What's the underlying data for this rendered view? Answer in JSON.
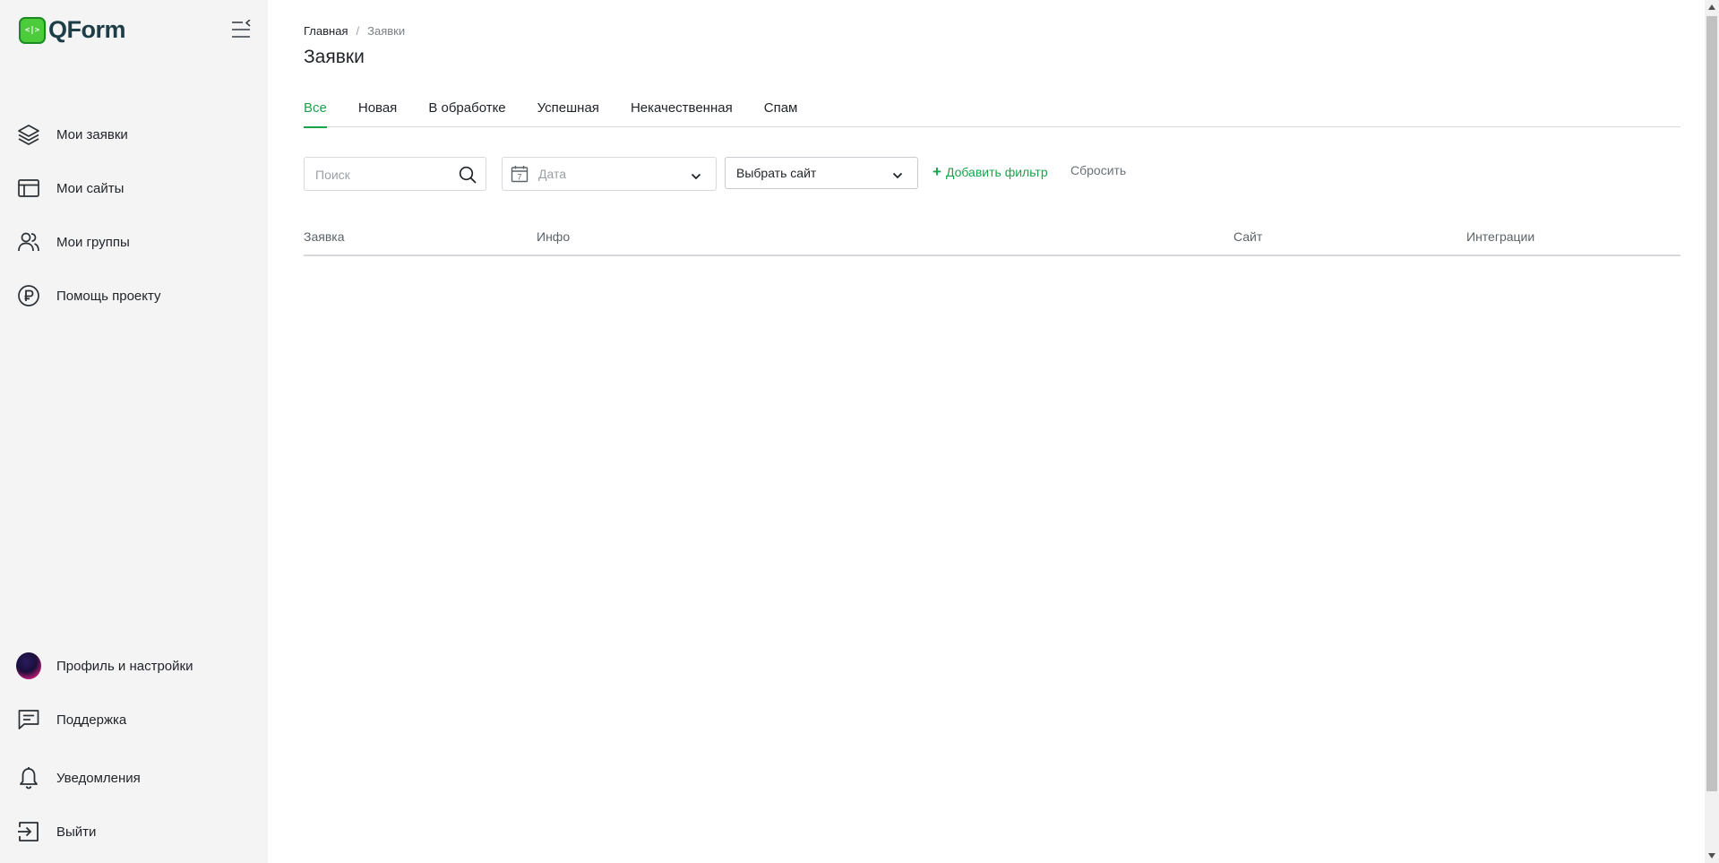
{
  "brand": {
    "logo_mark": "<|>",
    "name": "QForm",
    "accent": "#1aa34a",
    "logo_green": "#4ccc3a"
  },
  "sidebar": {
    "items": [
      {
        "label": "Мои заявки",
        "icon": "layers-icon"
      },
      {
        "label": "Мои сайты",
        "icon": "browser-window-icon"
      },
      {
        "label": "Мои группы",
        "icon": "users-icon"
      },
      {
        "label": "Помощь проекту",
        "icon": "ruble-coin-icon"
      }
    ],
    "bottom_items": [
      {
        "label": "Профиль и настройки",
        "icon": "avatar"
      },
      {
        "label": "Поддержка",
        "icon": "chat-icon"
      },
      {
        "label": "Уведомления",
        "icon": "bell-icon"
      },
      {
        "label": "Выйти",
        "icon": "logout-icon"
      }
    ]
  },
  "breadcrumb": {
    "home": "Главная",
    "separator": "/",
    "current": "Заявки"
  },
  "page": {
    "title": "Заявки"
  },
  "tabs": [
    {
      "label": "Все",
      "active": true
    },
    {
      "label": "Новая",
      "active": false
    },
    {
      "label": "В обработке",
      "active": false
    },
    {
      "label": "Успешная",
      "active": false
    },
    {
      "label": "Некачественная",
      "active": false
    },
    {
      "label": "Спам",
      "active": false
    }
  ],
  "filters": {
    "search_placeholder": "Поиск",
    "date_placeholder": "Дата",
    "calendar_day": "7",
    "site_select_value": "Выбрать сайт",
    "add_filter_label": "Добавить фильтр",
    "add_filter_plus": "+",
    "reset_label": "Сбросить"
  },
  "table": {
    "columns": [
      "Заявка",
      "Инфо",
      "Сайт",
      "Интеграции"
    ],
    "rows": []
  }
}
